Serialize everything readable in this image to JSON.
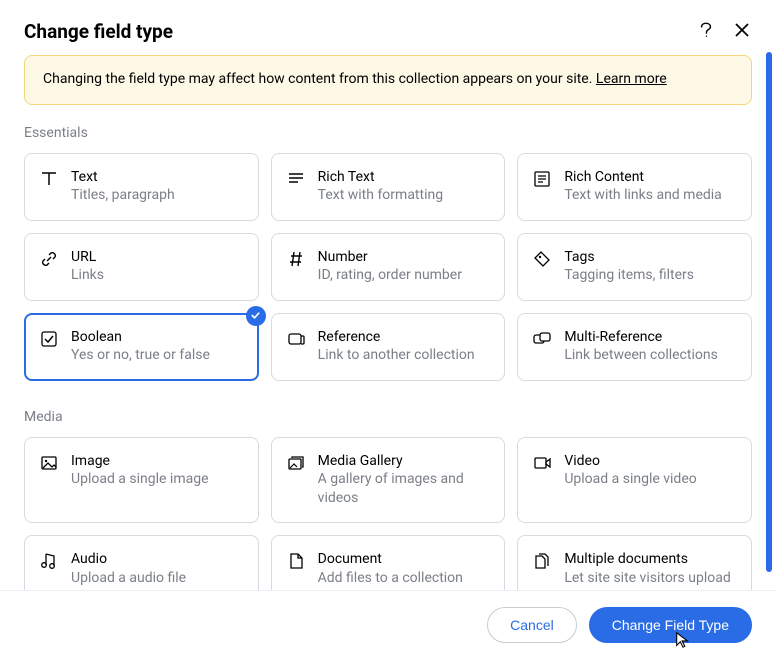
{
  "header": {
    "title": "Change field type"
  },
  "warning": {
    "text": "Changing the field type may affect how content from this collection appears on your site. ",
    "link": "Learn more"
  },
  "sections": [
    {
      "label": "Essentials",
      "items": [
        {
          "icon": "text-icon",
          "title": "Text",
          "desc": "Titles, paragraph",
          "selected": false
        },
        {
          "icon": "rich-text-icon",
          "title": "Rich Text",
          "desc": "Text with formatting",
          "selected": false
        },
        {
          "icon": "rich-content-icon",
          "title": "Rich Content",
          "desc": "Text with links and media",
          "selected": false
        },
        {
          "icon": "url-icon",
          "title": "URL",
          "desc": "Links",
          "selected": false
        },
        {
          "icon": "number-icon",
          "title": "Number",
          "desc": "ID, rating, order number",
          "selected": false
        },
        {
          "icon": "tags-icon",
          "title": "Tags",
          "desc": "Tagging items, filters",
          "selected": false
        },
        {
          "icon": "boolean-icon",
          "title": "Boolean",
          "desc": "Yes or no, true or false",
          "selected": true
        },
        {
          "icon": "reference-icon",
          "title": "Reference",
          "desc": "Link to another collection",
          "selected": false
        },
        {
          "icon": "multi-reference-icon",
          "title": "Multi-Reference",
          "desc": "Link between collections",
          "selected": false
        }
      ]
    },
    {
      "label": "Media",
      "items": [
        {
          "icon": "image-icon",
          "title": "Image",
          "desc": "Upload a single image",
          "selected": false
        },
        {
          "icon": "media-gallery-icon",
          "title": "Media Gallery",
          "desc": "A gallery of images and videos",
          "selected": false
        },
        {
          "icon": "video-icon",
          "title": "Video",
          "desc": "Upload a single video",
          "selected": false
        },
        {
          "icon": "audio-icon",
          "title": "Audio",
          "desc": "Upload a audio file",
          "selected": false
        },
        {
          "icon": "document-icon",
          "title": "Document",
          "desc": "Add files to a collection",
          "selected": false
        },
        {
          "icon": "multiple-documents-icon",
          "title": "Multiple documents",
          "desc": "Let site site visitors upload files to a collection",
          "selected": false
        }
      ]
    }
  ],
  "footer": {
    "cancel": "Cancel",
    "confirm": "Change Field Type"
  }
}
